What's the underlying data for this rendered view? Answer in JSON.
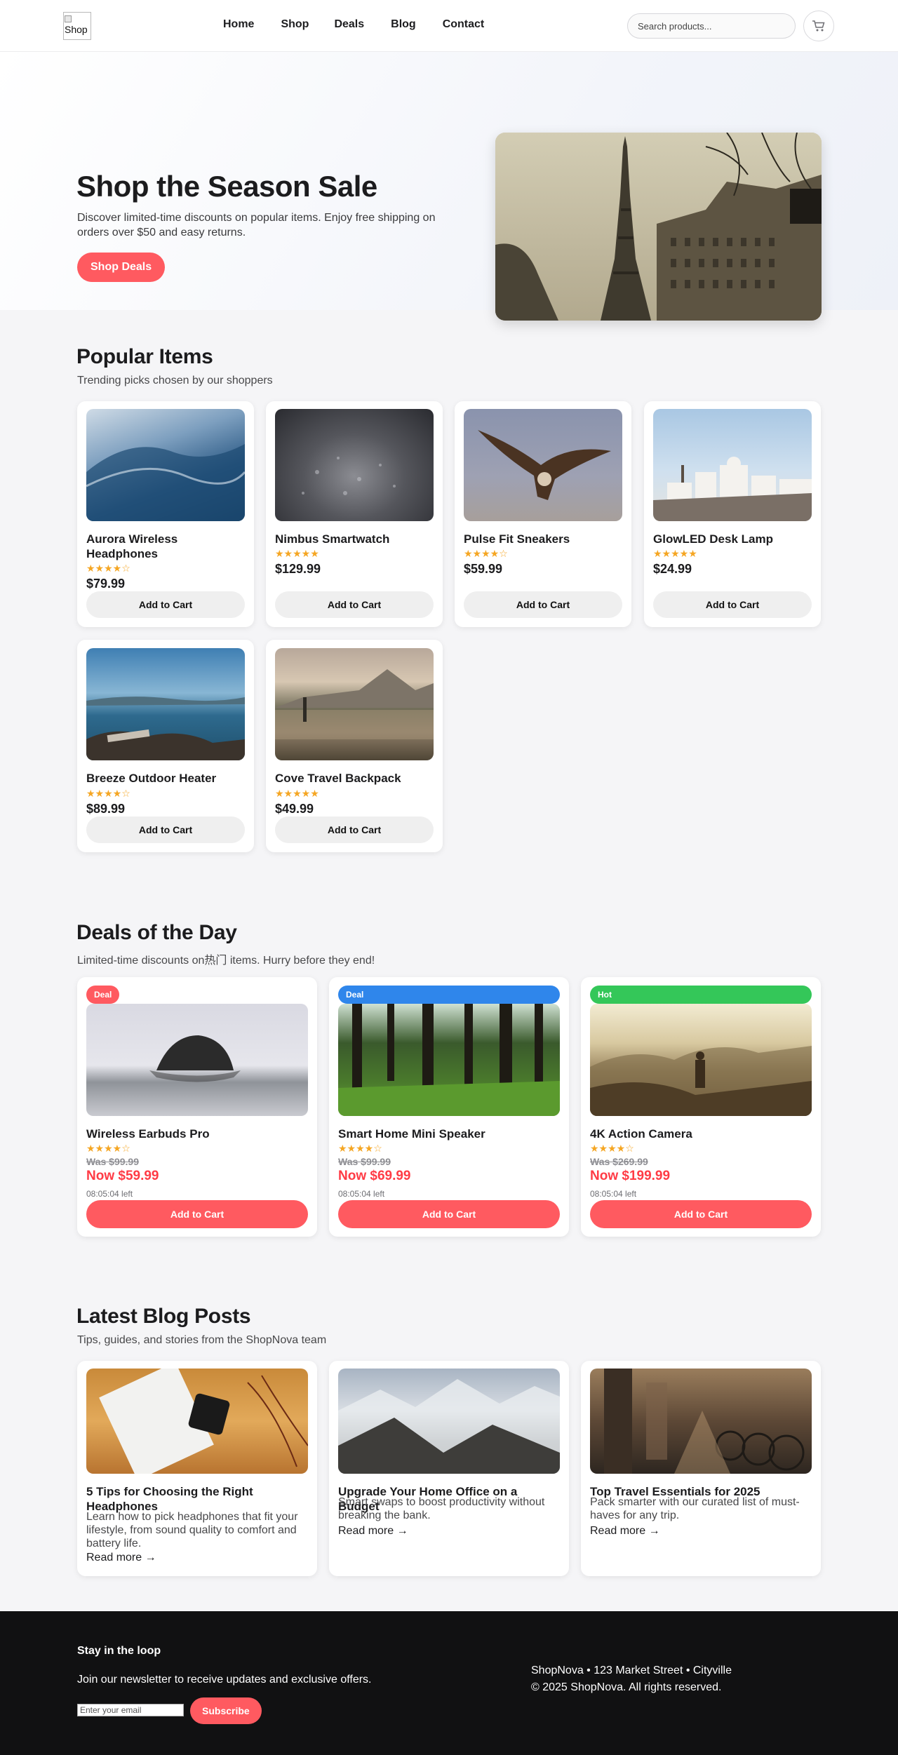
{
  "header": {
    "logo_alt": "Shop",
    "nav": [
      "Home",
      "Shop",
      "Deals",
      "Blog",
      "Contact"
    ],
    "search_placeholder": "Search products...",
    "cart_icon": "cart-icon"
  },
  "hero": {
    "title": "Shop the Season Sale",
    "text": "Discover limited-time discounts on popular items. Enjoy free shipping on orders over $50 and easy returns.",
    "cta": "Shop Deals"
  },
  "popular": {
    "title": "Popular Items",
    "subtitle": "Trending picks chosen by our shoppers",
    "button_label": "Add to Cart",
    "items": [
      {
        "name": "Aurora Wireless Headphones",
        "stars": "★★★★☆",
        "price": "$79.99"
      },
      {
        "name": "Nimbus Smartwatch",
        "stars": "★★★★★",
        "price": "$129.99"
      },
      {
        "name": "Pulse Fit Sneakers",
        "stars": "★★★★☆",
        "price": "$59.99"
      },
      {
        "name": "GlowLED Desk Lamp",
        "stars": "★★★★★",
        "price": "$24.99"
      },
      {
        "name": "Breeze Outdoor Heater",
        "stars": "★★★★☆",
        "price": "$89.99"
      },
      {
        "name": "Cove Travel Backpack",
        "stars": "★★★★★",
        "price": "$49.99"
      }
    ]
  },
  "deals": {
    "title": "Deals of the Day",
    "subtitle": "Limited-time discounts on热门 items. Hurry before they end!",
    "button_label": "Add to Cart",
    "items": [
      {
        "badge": "Deal",
        "badge_color": "#ff5a60",
        "name": "Wireless Earbuds Pro",
        "stars": "★★★★☆",
        "was": "Was $99.99",
        "now": "Now $59.99",
        "time_left": "08:05:04 left"
      },
      {
        "badge": "Deal",
        "badge_color": "#2f86eb",
        "name": "Smart Home Mini Speaker",
        "stars": "★★★★☆",
        "was": "Was $99.99",
        "now": "Now $69.99",
        "time_left": "08:05:04 left"
      },
      {
        "badge": "Hot",
        "badge_color": "#34c759",
        "name": "4K Action Camera",
        "stars": "★★★★☆",
        "was": "Was $269.99",
        "now": "Now $199.99",
        "time_left": "08:05:04 left"
      }
    ]
  },
  "blog": {
    "title": "Latest Blog Posts",
    "subtitle": "Tips, guides, and stories from the ShopNova team",
    "read_more": "Read more →",
    "posts": [
      {
        "title": "5 Tips for Choosing the Right Headphones",
        "excerpt": "Learn how to pick headphones that fit your lifestyle, from sound quality to comfort and battery life."
      },
      {
        "title": "Upgrade Your Home Office on a Budget",
        "excerpt": "Smart swaps to boost productivity without breaking the bank."
      },
      {
        "title": "Top Travel Essentials for 2025",
        "excerpt": "Pack smarter with our curated list of must-haves for any trip."
      }
    ]
  },
  "footer": {
    "heading": "Stay in the loop",
    "newsletter_text": "Join our newsletter to receive updates and exclusive offers.",
    "email_placeholder": "Enter your email",
    "subscribe": "Subscribe",
    "address": "ShopNova • 123 Market Street • Cityville",
    "copyright": "© 2025 ShopNova. All rights reserved."
  }
}
